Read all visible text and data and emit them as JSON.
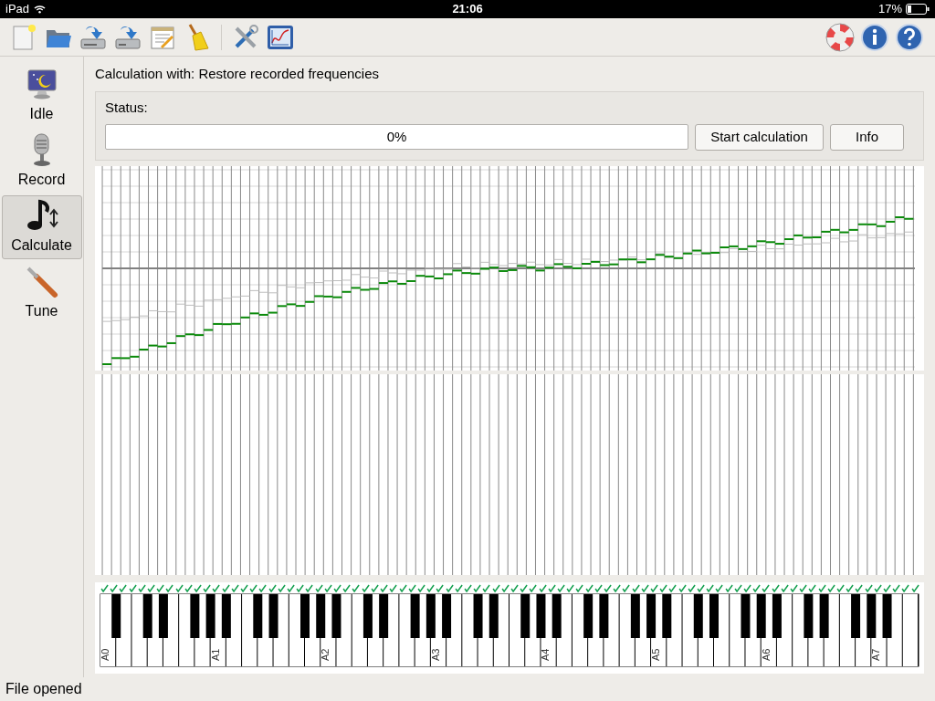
{
  "device_bar": {
    "carrier": "iPad",
    "time": "21:06",
    "battery": "17%"
  },
  "sidebar": {
    "items": [
      {
        "label": "Idle",
        "selected": false
      },
      {
        "label": "Record",
        "selected": false
      },
      {
        "label": "Calculate",
        "selected": true
      },
      {
        "label": "Tune",
        "selected": false
      }
    ]
  },
  "calculation": {
    "title": "Calculation with: Restore recorded frequencies",
    "status_label": "Status:",
    "progress": {
      "level": 0,
      "reading": "0%"
    },
    "buttons": [
      "Start calculation",
      "Info"
    ]
  },
  "keyboard": {
    "octave_labels": [
      "A0",
      "A1",
      "A2",
      "A3",
      "A4",
      "A5",
      "A6",
      "A7"
    ],
    "all_recorded": true
  },
  "status_message": "File opened"
}
